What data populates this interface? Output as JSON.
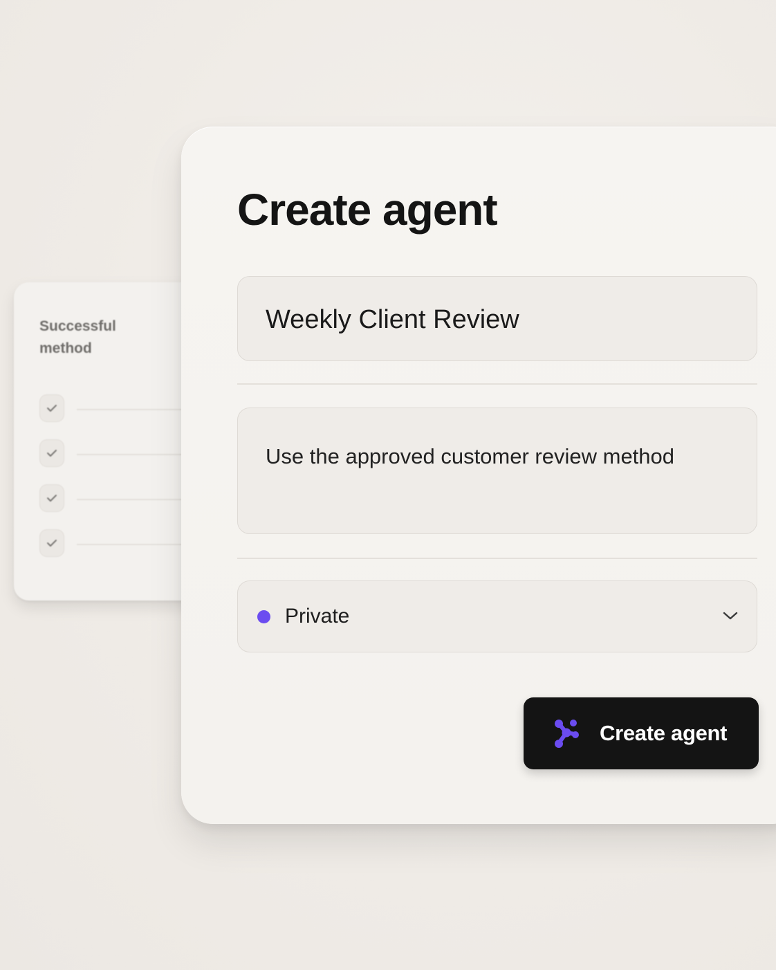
{
  "back_card": {
    "title": "Successful method",
    "checklist_items": [
      {
        "checked": true
      },
      {
        "checked": true
      },
      {
        "checked": true
      },
      {
        "checked": true
      }
    ]
  },
  "dialog": {
    "title": "Create agent",
    "name_field": {
      "value": "Weekly Client Review"
    },
    "instructions_field": {
      "value": "Use the approved customer review method"
    },
    "visibility_select": {
      "selected": "Private",
      "dot_color": "#6b4cf0"
    },
    "submit_button": {
      "label": "Create agent",
      "icon": "agent-network-icon",
      "icon_color": "#6b4cf0",
      "background": "#141414"
    }
  }
}
